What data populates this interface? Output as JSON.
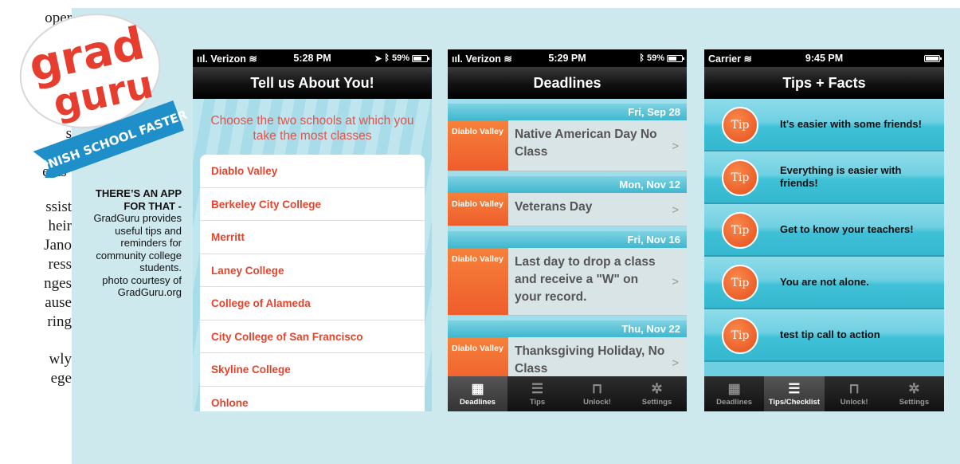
{
  "article_fragments": [
    "oper",
    "s",
    "ease",
    "ents’",
    "ssist",
    "heir",
    "Jano",
    "ress",
    "nges",
    "ause",
    "ring",
    "wly",
    "ege"
  ],
  "logo": {
    "line1": "grad",
    "line2": "guru",
    "ribbon": "FINISH SCHOOL FASTER"
  },
  "caption": {
    "title": "THERE’S AN APP FOR THAT -",
    "body": "GradGuru provides useful tips and reminders for community college students.",
    "credit": "photo courtesy of GradGuru.org"
  },
  "phone1": {
    "status": {
      "carrier": "Verizon",
      "time": "5:28 PM",
      "battery": "59%"
    },
    "title": "Tell us About You!",
    "prompt": "Choose the two schools at which you take the most classes",
    "schools": [
      "Diablo Valley",
      "Berkeley City College",
      "Merritt",
      "Laney College",
      "College of Alameda",
      "City College of San Francisco",
      "Skyline College",
      "Ohlone"
    ]
  },
  "phone2": {
    "status": {
      "carrier": "Verizon",
      "time": "5:29 PM",
      "battery": "59%"
    },
    "title": "Deadlines",
    "groups": [
      {
        "date": "Fri, Sep 28",
        "school": "Diablo Valley",
        "event": "Native American Day No Class"
      },
      {
        "date": "Mon, Nov 12",
        "school": "Diablo Valley",
        "event": "Veterans Day"
      },
      {
        "date": "Fri, Nov 16",
        "school": "Diablo Valley",
        "event": "Last day to drop a class and receive a \"W\" on your record."
      },
      {
        "date": "Thu, Nov 22",
        "school": "Diablo Valley",
        "event": "Thanksgiving Holiday, No Class"
      }
    ],
    "tabs": [
      "Deadlines",
      "Tips",
      "Unlock!",
      "Settings"
    ],
    "active_tab": "Deadlines"
  },
  "phone3": {
    "status": {
      "carrier": "Carrier",
      "time": "9:45 PM"
    },
    "title": "Tips + Facts",
    "badge_label": "Tip",
    "tips": [
      "It's easier with some friends!",
      "Everything is easier with friends!",
      "Get to know your teachers!",
      "You are not alone.",
      "test tip call to action"
    ],
    "tabs": [
      "Deadlines",
      "Tips/Checklist",
      "Unlock!",
      "Settings"
    ],
    "active_tab": "Tips/Checklist"
  },
  "colors": {
    "panel": "#cde9ee",
    "accent_orange": "#ee5d2c",
    "school_red": "#e5442c",
    "logo_red": "#e63d2f",
    "ribbon_blue": "#1e8fc9"
  },
  "icons": {
    "signal": "signal-bars-icon",
    "wifi": "wifi-icon",
    "location": "location-arrow-icon",
    "bluetooth": "bluetooth-icon",
    "calendar": "calendar-icon",
    "list": "list-icon",
    "lock": "lock-icon",
    "gear": "gear-icon"
  }
}
